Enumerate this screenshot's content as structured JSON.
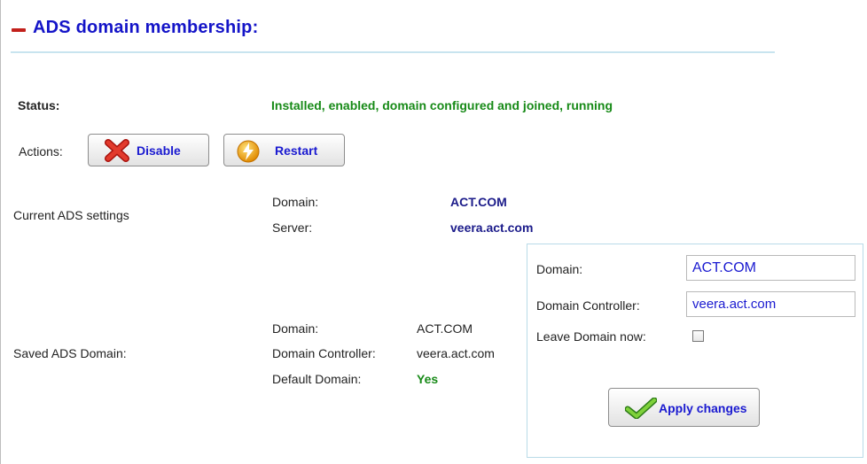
{
  "header": {
    "title": "ADS domain membership:"
  },
  "status": {
    "label": "Status:",
    "value": "Installed, enabled, domain configured and joined, running"
  },
  "actions": {
    "label": "Actions:",
    "disable_label": "Disable",
    "restart_label": "Restart"
  },
  "current": {
    "section_label": "Current ADS settings",
    "domain_label": "Domain:",
    "domain_value": "ACT.COM",
    "server_label": "Server:",
    "server_value": "veera.act.com"
  },
  "saved": {
    "section_label": "Saved ADS Domain:",
    "domain_label": "Domain:",
    "domain_value": "ACT.COM",
    "controller_label": "Domain Controller:",
    "controller_value": "veera.act.com",
    "default_label": "Default Domain:",
    "default_value": "Yes"
  },
  "form": {
    "domain_label": "Domain:",
    "domain_value": "ACT.COM",
    "controller_label": "Domain Controller:",
    "controller_value": "veera.act.com",
    "leave_label": "Leave Domain now:",
    "leave_checked": false,
    "apply_label": "Apply changes"
  },
  "colors": {
    "title": "#1414c8",
    "ok_green": "#178a17",
    "value_navy": "#1b1b8a",
    "accent_line": "#c8e4ef"
  },
  "icons": {
    "collapse": "minus-icon",
    "disable": "red-x-icon",
    "restart": "lightning-icon",
    "apply": "checkmark-icon"
  }
}
